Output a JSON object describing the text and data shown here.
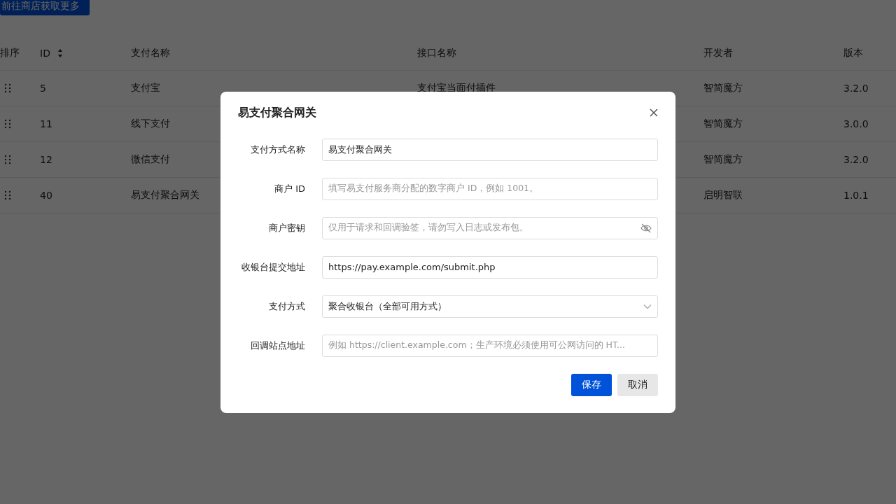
{
  "top_button": {
    "label": "前往商店获取更多"
  },
  "table": {
    "columns": [
      {
        "label": "排序",
        "sortable": false
      },
      {
        "label": "ID",
        "sortable": true
      },
      {
        "label": "支付名称",
        "sortable": false
      },
      {
        "label": "接口名称",
        "sortable": false
      },
      {
        "label": "开发者",
        "sortable": false
      },
      {
        "label": "版本",
        "sortable": false
      }
    ],
    "rows": [
      {
        "id": "5",
        "name": "支付宝",
        "interface": "支付宝当面付插件",
        "developer": "智简魔方",
        "version": "3.2.0"
      },
      {
        "id": "11",
        "name": "线下支付",
        "developer": "智简魔方",
        "version": "3.0.0"
      },
      {
        "id": "12",
        "name": "微信支付",
        "developer": "智简魔方",
        "version": "3.2.0"
      },
      {
        "id": "40",
        "name": "易支付聚合网关",
        "developer": "启明智联",
        "version": "1.0.1"
      }
    ]
  },
  "dialog": {
    "title": "易支付聚合网关",
    "fields": [
      {
        "kind": "text",
        "label": "支付方式名称",
        "value": "易支付聚合网关"
      },
      {
        "kind": "text",
        "label": "商户 ID",
        "placeholder": "填写易支付服务商分配的数字商户 ID，例如 1001。"
      },
      {
        "kind": "password",
        "label": "商户密钥",
        "placeholder": "仅用于请求和回调验签，请勿写入日志或发布包。"
      },
      {
        "kind": "text",
        "label": "收银台提交地址",
        "value": "https://pay.example.com/submit.php"
      },
      {
        "kind": "select",
        "label": "支付方式",
        "value": "聚合收银台（全部可用方式）"
      },
      {
        "kind": "text",
        "label": "回调站点地址",
        "placeholder": "例如 https://client.example.com；生产环境必须使用可公网访问的 HT..."
      }
    ],
    "buttons": [
      {
        "label": "保存",
        "kind": "primary"
      },
      {
        "label": "取消",
        "kind": "secondary"
      }
    ]
  }
}
